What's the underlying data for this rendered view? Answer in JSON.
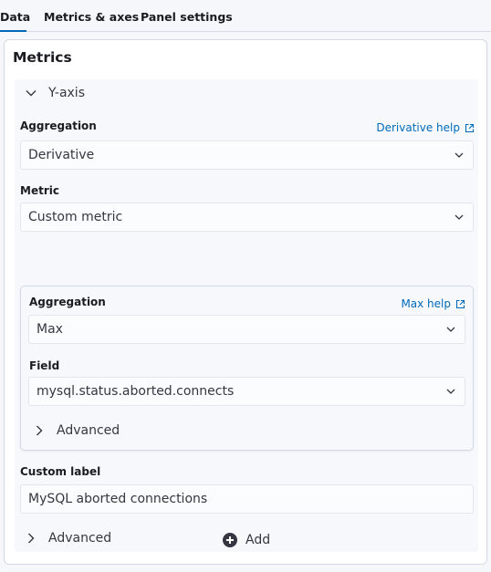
{
  "tabs": [
    {
      "label": "Data",
      "active": true
    },
    {
      "label": "Metrics & axes",
      "active": false
    },
    {
      "label": "Panel settings",
      "active": false
    }
  ],
  "panel": {
    "title": "Metrics",
    "yaxis_toggle": "Y-axis",
    "aggregation": {
      "label": "Aggregation",
      "help": "Derivative help",
      "value": "Derivative"
    },
    "metric": {
      "label": "Metric",
      "value": "Custom metric"
    },
    "sub": {
      "aggregation_label": "Aggregation",
      "aggregation_help": "Max help",
      "aggregation_value": "Max",
      "field_label": "Field",
      "field_value": "mysql.status.aborted.connects",
      "advanced": "Advanced"
    },
    "custom_label": {
      "label": "Custom label",
      "value": "MySQL aborted connections"
    },
    "advanced": "Advanced",
    "add": "Add"
  },
  "colors": {
    "link": "#006bb8",
    "text": "#343741",
    "border": "#d3dae6"
  }
}
